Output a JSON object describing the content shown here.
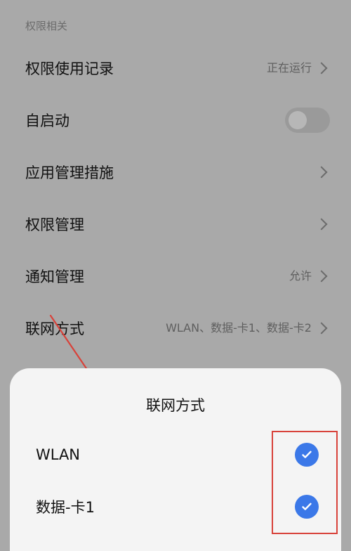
{
  "section": {
    "header": "权限相关"
  },
  "rows": [
    {
      "title": "权限使用记录",
      "value": "正在运行",
      "icon": "chevron-right-icon"
    },
    {
      "title": "自启动",
      "toggle": "off"
    },
    {
      "title": "应用管理措施",
      "icon": "chevron-right-icon"
    },
    {
      "title": "权限管理",
      "icon": "chevron-right-icon"
    },
    {
      "title": "通知管理",
      "value": "允许",
      "icon": "chevron-right-icon"
    },
    {
      "title": "联网方式",
      "value": "WLAN、数据-卡1、数据-卡2",
      "icon": "chevron-right-icon"
    }
  ],
  "sheet": {
    "title": "联网方式",
    "items": [
      {
        "label": "WLAN",
        "checked": true
      },
      {
        "label": "数据-卡1",
        "checked": true
      }
    ]
  },
  "colors": {
    "accent": "#3b78e8",
    "annotation": "#d8423a",
    "overlay": "#a9a9a9"
  }
}
